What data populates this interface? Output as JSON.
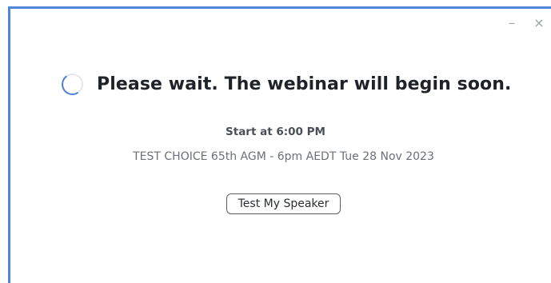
{
  "window": {
    "controls": {
      "minimize": "–",
      "close": "×"
    }
  },
  "main": {
    "heading": "Please wait. The webinar will begin soon.",
    "start_time": "Start at 6:00 PM",
    "meeting_title": "TEST CHOICE 65th AGM - 6pm AEDT Tue 28 Nov 2023",
    "test_speaker_label": "Test My Speaker",
    "spinner_icon": "loading-spinner"
  },
  "colors": {
    "accent_border": "#4f86d8",
    "spinner": "#4a7fcf",
    "heading_text": "#1f2329"
  }
}
